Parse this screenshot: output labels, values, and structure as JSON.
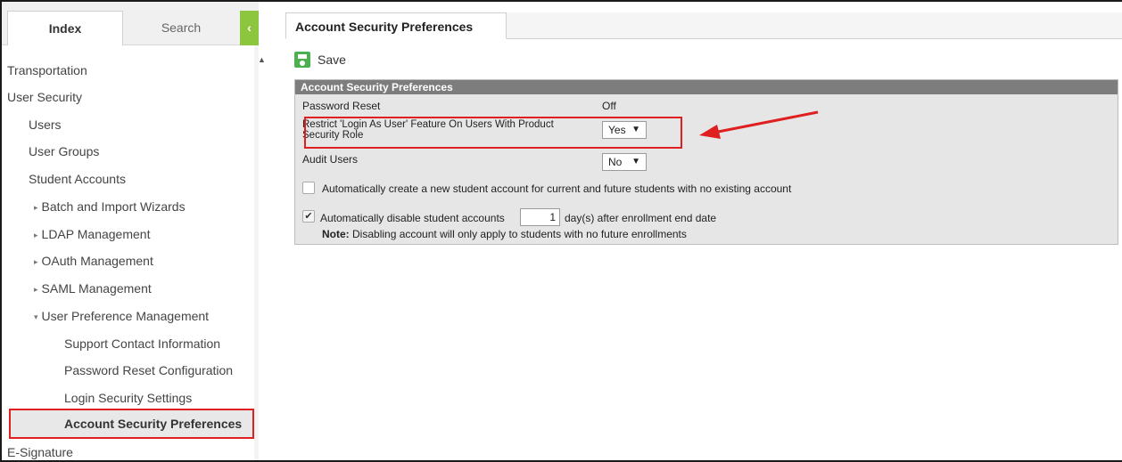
{
  "sidebar": {
    "tabs": {
      "index": "Index",
      "search": "Search",
      "collapse": "‹"
    },
    "items": [
      {
        "label": "Transportation",
        "caret": ""
      },
      {
        "label": "User Security",
        "caret": ""
      },
      {
        "label": "Users",
        "caret": ""
      },
      {
        "label": "User Groups",
        "caret": ""
      },
      {
        "label": "Student Accounts",
        "caret": ""
      },
      {
        "label": "Batch and Import Wizards",
        "caret": "▸"
      },
      {
        "label": "LDAP Management",
        "caret": "▸"
      },
      {
        "label": "OAuth Management",
        "caret": "▸"
      },
      {
        "label": "SAML Management",
        "caret": "▸"
      },
      {
        "label": "User Preference Management",
        "caret": "▾"
      },
      {
        "label": "Support Contact Information",
        "caret": ""
      },
      {
        "label": "Password Reset Configuration",
        "caret": ""
      },
      {
        "label": "Login Security Settings",
        "caret": ""
      },
      {
        "label": "Account Security Preferences",
        "caret": ""
      },
      {
        "label": "E-Signature",
        "caret": ""
      }
    ]
  },
  "main": {
    "tab_label": "Account Security Preferences",
    "save_label": "Save",
    "panel_title": "Account Security Preferences",
    "password_reset_label": "Password Reset",
    "password_reset_value": "Off",
    "restrict_label_line1": "Restrict 'Login As User' Feature On Users With Product",
    "restrict_label_line2": "Security Role",
    "restrict_value": "Yes",
    "audit_label": "Audit Users",
    "audit_value": "No",
    "auto_create_label": "Automatically create a new student account for current and future students with no existing account",
    "auto_create_checked": false,
    "auto_disable_label": "Automatically disable student accounts",
    "auto_disable_checked": true,
    "auto_disable_days": "1",
    "auto_disable_suffix": "day(s) after enrollment end date",
    "note_label": "Note:",
    "note_text": "Disabling account will only apply to students with no future enrollments",
    "dropdown_arrow": "▼",
    "check_mark": "✔"
  },
  "colors": {
    "accent_green": "#8cc63f",
    "highlight_red": "#e02020",
    "panel_header": "#7d7d7d"
  }
}
